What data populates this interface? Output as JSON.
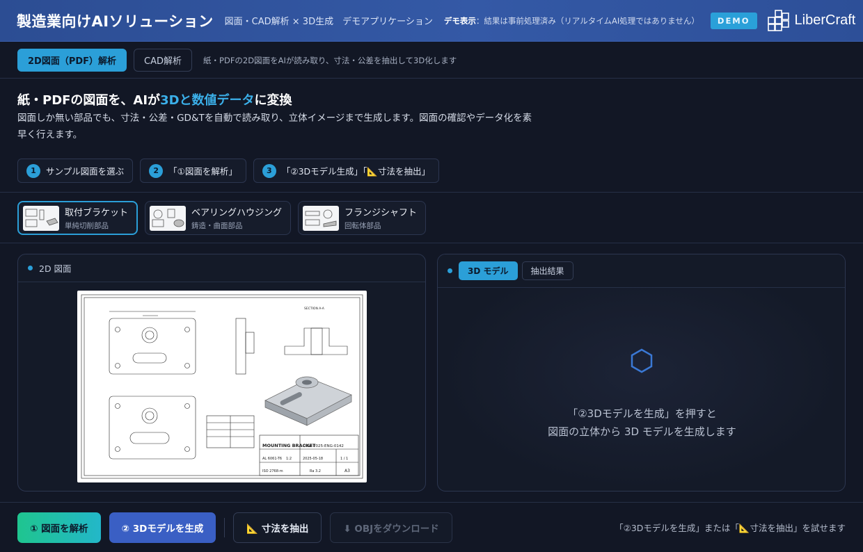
{
  "header": {
    "title": "製造業向けAIソリューション",
    "subtitle": "図面・CAD解析 × 3D生成　デモアプリケーション",
    "demo_label": "デモ表示",
    "demo_note": "：結果は事前処理済み（リアルタイムAI処理ではありません）",
    "badge": "DEMO",
    "logo_text": "LiberCraft"
  },
  "modes": {
    "tabs": [
      {
        "label": "2D図面（PDF）解析",
        "active": true
      },
      {
        "label": "CAD解析",
        "active": false
      }
    ],
    "description": "紙・PDFの2D図面をAIが読み取り、寸法・公差を抽出して3D化します"
  },
  "hero": {
    "title_prefix": "紙・PDFの図面を、AIが",
    "title_highlight": "3Dと数値データ",
    "title_suffix": "に変換",
    "description": "図面しか無い部品でも、寸法・公差・GD&Tを自動で読み取り、立体イメージまで生成します。図面の確認やデータ化を素早く行えます。"
  },
  "steps": [
    {
      "num": "1",
      "label": "サンプル図面を選ぶ"
    },
    {
      "num": "2",
      "label": "「①図面を解析」"
    },
    {
      "num": "3",
      "label": "「②3Dモデル生成」「📐寸法を抽出」"
    }
  ],
  "samples": [
    {
      "name": "取付ブラケット",
      "desc": "単純切削部品",
      "active": true
    },
    {
      "name": "ベアリングハウジング",
      "desc": "鋳造・曲面部品",
      "active": false
    },
    {
      "name": "フランジシャフト",
      "desc": "回転体部品",
      "active": false
    }
  ],
  "left_panel": {
    "title": "2D 図面",
    "drawing": {
      "part_name": "MOUNTING BRACKET",
      "drawing_no": "DRW-2025-ENG-0142",
      "material": "AL 6061-T6",
      "scale": "1:2",
      "date": "2025-05-18",
      "sheet": "1 / 1",
      "tolerance": "ISO 2768-m",
      "finish": "Ra 3.2",
      "size": "A3",
      "section": "SECTION A-A"
    }
  },
  "right_panel": {
    "tabs": [
      {
        "label": "3D モデル",
        "active": true
      },
      {
        "label": "抽出結果",
        "active": false
      }
    ],
    "placeholder_line1": "「②3Dモデルを生成」を押すと",
    "placeholder_line2": "図面の立体から 3D モデルを生成します"
  },
  "actions": {
    "analyze": "① 図面を解析",
    "generate": "② 3Dモデルを生成",
    "measure": "📐 寸法を抽出",
    "download": "⬇ OBJをダウンロード",
    "hint": "「②3Dモデルを生成」または「📐寸法を抽出」を試せます"
  },
  "colors": {
    "accent": "#2b9fd8",
    "header_bg": "#3459a6",
    "background": "#121725",
    "generate_btn": "#3a5fc4",
    "analyze_btn_start": "#1fc58f"
  }
}
